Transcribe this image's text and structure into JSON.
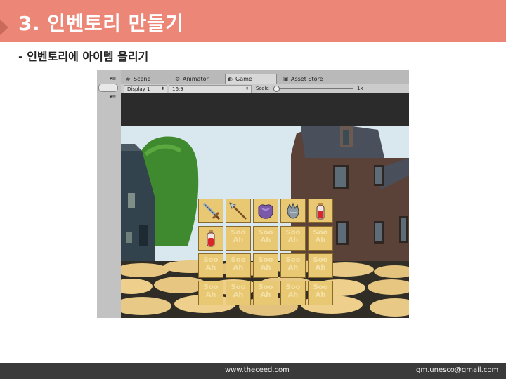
{
  "slide": {
    "title": "3. 인벤토리 만들기",
    "subtitle": "- 인벤토리에 아이템 올리기"
  },
  "unity": {
    "tabs": [
      {
        "label": "Scene",
        "icon": "scene-icon",
        "active": false
      },
      {
        "label": "Animator",
        "icon": "animator-icon",
        "active": false
      },
      {
        "label": "Game",
        "icon": "game-icon",
        "active": true
      },
      {
        "label": "Asset Store",
        "icon": "asset-store-icon",
        "active": false
      }
    ],
    "toolbar": {
      "display": "Display 1",
      "aspect": "16:9",
      "scale_label": "Scale",
      "scale_value": "1x"
    }
  },
  "inventory": {
    "rows": 4,
    "cols": 5,
    "empty_slot_logo": [
      "Soo",
      "Ah"
    ],
    "items": [
      {
        "slot": 0,
        "name": "sword-icon"
      },
      {
        "slot": 1,
        "name": "spear-icon"
      },
      {
        "slot": 2,
        "name": "armor-icon"
      },
      {
        "slot": 3,
        "name": "gauntlet-icon"
      },
      {
        "slot": 4,
        "name": "red-potion-icon"
      },
      {
        "slot": 5,
        "name": "red-potion-icon"
      }
    ]
  },
  "footer": {
    "website": "www.theceed.com",
    "email": "gm.unesco@gmail.com"
  },
  "colors": {
    "title_bar": "#ec8676",
    "footer_bar": "#3a3a3a",
    "slot_fill": "#e8c873"
  }
}
